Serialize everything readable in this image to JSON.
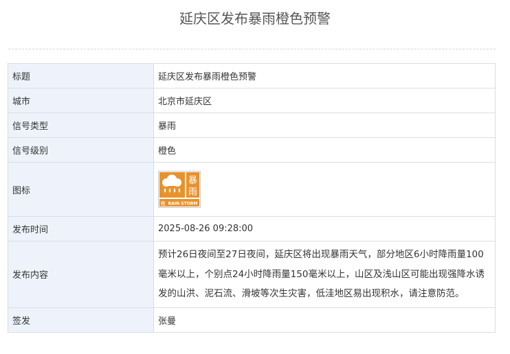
{
  "page_title": "延庆区发布暴雨橙色预警",
  "rows": [
    {
      "label": "标题",
      "value": "延庆区发布暴雨橙色预警"
    },
    {
      "label": "城市",
      "value": "北京市延庆区"
    },
    {
      "label": "信号类型",
      "value": "暴雨"
    },
    {
      "label": "信号级别",
      "value": "橙色"
    },
    {
      "label": "图标",
      "icon": {
        "name": "rainstorm-orange-icon",
        "char1": "暴",
        "char2": "雨",
        "small": "橙",
        "caption": "RAIN STORM",
        "color": "#e8922c"
      }
    },
    {
      "label": "发布时间",
      "value": "2025-08-26 09:28:00"
    },
    {
      "label": "发布内容",
      "value": "预计26日夜间至27日夜间，延庆区将出现暴雨天气，部分地区6小时降雨量100毫米以上，个别点24小时降雨量150毫米以上，山区及浅山区可能出现强降水诱发的山洪、泥石流、滑坡等次生灾害，低洼地区易出现积水，请注意防范。"
    },
    {
      "label": "签发",
      "value": "张曼"
    }
  ]
}
